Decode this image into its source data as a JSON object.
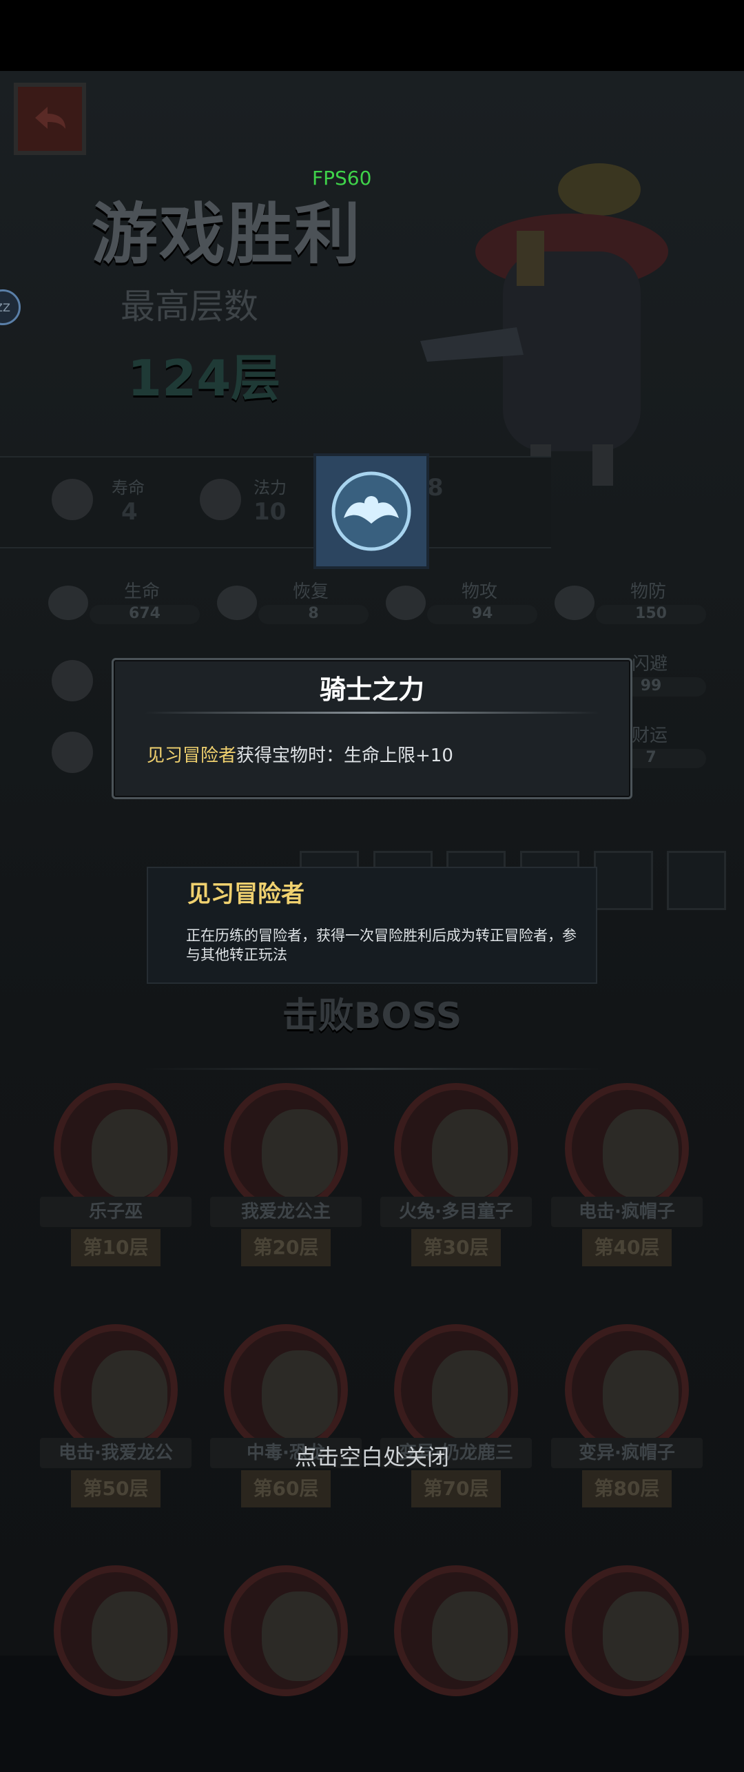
{
  "status": {
    "fps": "FPS60",
    "float_button": "ZZ"
  },
  "header": {
    "title": "游戏胜利",
    "best_floor_label": "最高层数",
    "best_floor_value": "124层"
  },
  "mini_stats": [
    {
      "label": "寿命",
      "value": "4"
    },
    {
      "label": "法力",
      "value": "10"
    },
    {
      "label": "",
      "value": "8"
    }
  ],
  "stats_row1": [
    {
      "label": "生命",
      "value": "674"
    },
    {
      "label": "恢复",
      "value": "8"
    },
    {
      "label": "物攻",
      "value": "94"
    },
    {
      "label": "物防",
      "value": "150"
    }
  ],
  "stats_right": [
    {
      "label": "闪避",
      "value": "99"
    },
    {
      "label": "财运",
      "value": "7"
    }
  ],
  "tooltip": {
    "title": "骑士之力",
    "desc_highlight": "见习冒险者",
    "desc_rest": "获得宝物时：生命上限+10"
  },
  "role_card": {
    "title": "见习冒险者",
    "desc": "正在历练的冒险者，获得一次冒险胜利后成为转正冒险者，参与其他转正玩法"
  },
  "boss_section": {
    "title": "击败BOSS",
    "bosses": [
      {
        "name": "乐子巫",
        "floor": "第10层"
      },
      {
        "name": "我爱龙公主",
        "floor": "第20层"
      },
      {
        "name": "火兔·多目童子",
        "floor": "第30层"
      },
      {
        "name": "电击·疯帽子",
        "floor": "第40层"
      },
      {
        "name": "电击·我爱龙公",
        "floor": "第50层"
      },
      {
        "name": "中毒·恐龙",
        "floor": "第60层"
      },
      {
        "name": "变异·奶龙鹿三",
        "floor": "第70层"
      },
      {
        "name": "变异·疯帽子",
        "floor": "第80层"
      }
    ]
  },
  "close_hint": "点击空白处关闭",
  "colors": {
    "highlight": "#f0d16f",
    "fps": "#3fd34a",
    "background": "#0b0d10"
  }
}
